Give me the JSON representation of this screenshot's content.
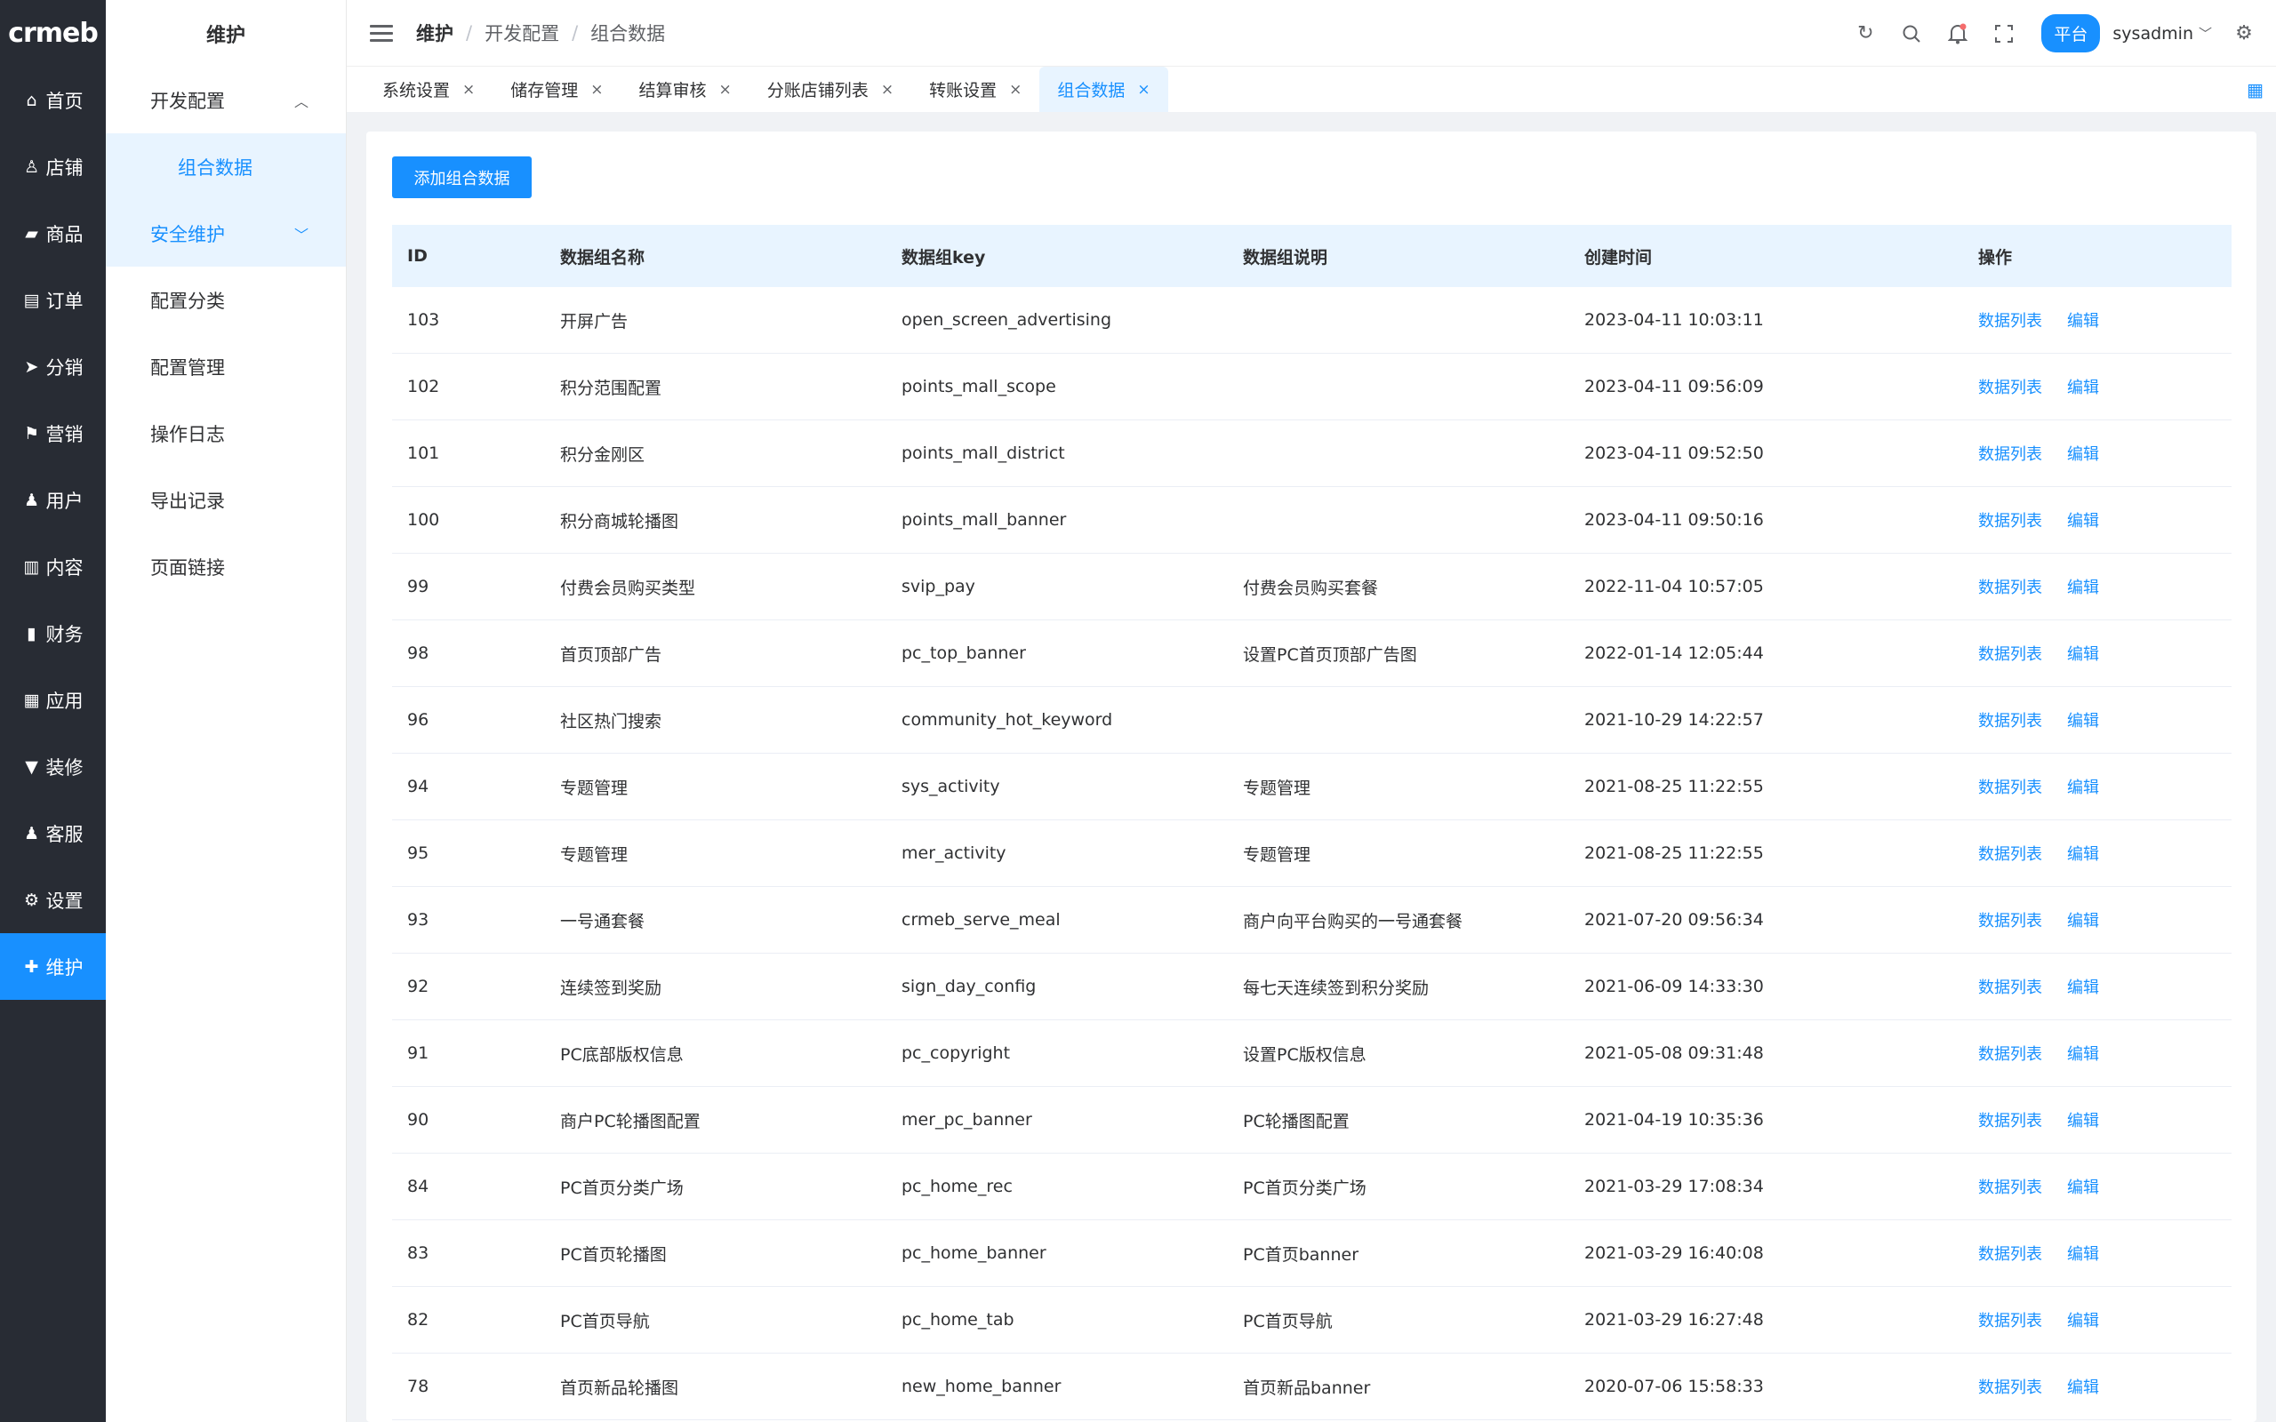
{
  "logo": "crmeb",
  "rail": [
    {
      "icon": "home-icon",
      "glyph": "⌂",
      "label": "首页"
    },
    {
      "icon": "store-icon",
      "glyph": "♙",
      "label": "店铺"
    },
    {
      "icon": "bag-icon",
      "glyph": "▰",
      "label": "商品"
    },
    {
      "icon": "order-icon",
      "glyph": "▤",
      "label": "订单"
    },
    {
      "icon": "send-icon",
      "glyph": "➤",
      "label": "分销"
    },
    {
      "icon": "flag-icon",
      "glyph": "⚑",
      "label": "营销"
    },
    {
      "icon": "user-icon",
      "glyph": "♟",
      "label": "用户"
    },
    {
      "icon": "book-icon",
      "glyph": "▥",
      "label": "内容"
    },
    {
      "icon": "bar-chart-icon",
      "glyph": "▮",
      "label": "财务"
    },
    {
      "icon": "apps-icon",
      "glyph": "▦",
      "label": "应用"
    },
    {
      "icon": "brush-icon",
      "glyph": "▼",
      "label": "装修"
    },
    {
      "icon": "service-icon",
      "glyph": "♟",
      "label": "客服"
    },
    {
      "icon": "gear-icon",
      "glyph": "⚙",
      "label": "设置"
    },
    {
      "icon": "maintain-icon",
      "glyph": "✚",
      "label": "维护"
    }
  ],
  "submenu": {
    "title": "维护",
    "dev_config": "开发配置",
    "combo_data": "组合数据",
    "security": "安全维护",
    "items": [
      "配置分类",
      "配置管理",
      "操作日志",
      "导出记录",
      "页面链接"
    ]
  },
  "breadcrumb": {
    "home": "维护",
    "level1": "开发配置",
    "level2": "组合数据"
  },
  "header": {
    "platform": "平台",
    "user": "sysadmin"
  },
  "tabs": [
    {
      "label": "系统设置",
      "active": false
    },
    {
      "label": "储存管理",
      "active": false
    },
    {
      "label": "结算审核",
      "active": false
    },
    {
      "label": "分账店铺列表",
      "active": false
    },
    {
      "label": "转账设置",
      "active": false
    },
    {
      "label": "组合数据",
      "active": true
    }
  ],
  "add_button": "添加组合数据",
  "table": {
    "columns": [
      "ID",
      "数据组名称",
      "数据组key",
      "数据组说明",
      "创建时间",
      "操作"
    ],
    "op_list": "数据列表",
    "op_edit": "编辑",
    "rows": [
      {
        "id": "103",
        "name": "开屏广告",
        "key": "open_screen_advertising",
        "desc": "",
        "time": "2023-04-11 10:03:11"
      },
      {
        "id": "102",
        "name": "积分范围配置",
        "key": "points_mall_scope",
        "desc": "",
        "time": "2023-04-11 09:56:09"
      },
      {
        "id": "101",
        "name": "积分金刚区",
        "key": "points_mall_district",
        "desc": "",
        "time": "2023-04-11 09:52:50"
      },
      {
        "id": "100",
        "name": "积分商城轮播图",
        "key": "points_mall_banner",
        "desc": "",
        "time": "2023-04-11 09:50:16"
      },
      {
        "id": "99",
        "name": "付费会员购买类型",
        "key": "svip_pay",
        "desc": "付费会员购买套餐",
        "time": "2022-11-04 10:57:05"
      },
      {
        "id": "98",
        "name": "首页顶部广告",
        "key": "pc_top_banner",
        "desc": "设置PC首页顶部广告图",
        "time": "2022-01-14 12:05:44"
      },
      {
        "id": "96",
        "name": "社区热门搜索",
        "key": "community_hot_keyword",
        "desc": "",
        "time": "2021-10-29 14:22:57"
      },
      {
        "id": "94",
        "name": "专题管理",
        "key": "sys_activity",
        "desc": "专题管理",
        "time": "2021-08-25 11:22:55"
      },
      {
        "id": "95",
        "name": "专题管理",
        "key": "mer_activity",
        "desc": "专题管理",
        "time": "2021-08-25 11:22:55"
      },
      {
        "id": "93",
        "name": "一号通套餐",
        "key": "crmeb_serve_meal",
        "desc": "商户向平台购买的一号通套餐",
        "time": "2021-07-20 09:56:34"
      },
      {
        "id": "92",
        "name": "连续签到奖励",
        "key": "sign_day_config",
        "desc": "每七天连续签到积分奖励",
        "time": "2021-06-09 14:33:30"
      },
      {
        "id": "91",
        "name": "PC底部版权信息",
        "key": "pc_copyright",
        "desc": "设置PC版权信息",
        "time": "2021-05-08 09:31:48"
      },
      {
        "id": "90",
        "name": "商户PC轮播图配置",
        "key": "mer_pc_banner",
        "desc": "PC轮播图配置",
        "time": "2021-04-19 10:35:36"
      },
      {
        "id": "84",
        "name": "PC首页分类广场",
        "key": "pc_home_rec",
        "desc": "PC首页分类广场",
        "time": "2021-03-29 17:08:34"
      },
      {
        "id": "83",
        "name": "PC首页轮播图",
        "key": "pc_home_banner",
        "desc": "PC首页banner",
        "time": "2021-03-29 16:40:08"
      },
      {
        "id": "82",
        "name": "PC首页导航",
        "key": "pc_home_tab",
        "desc": "PC首页导航",
        "time": "2021-03-29 16:27:48"
      },
      {
        "id": "78",
        "name": "首页新品轮播图",
        "key": "new_home_banner",
        "desc": "首页新品banner",
        "time": "2020-07-06 15:58:33"
      }
    ]
  },
  "colors": {
    "accent": "#1890ff",
    "rail_bg": "#282c34",
    "active_bg": "#e8f4ff"
  }
}
